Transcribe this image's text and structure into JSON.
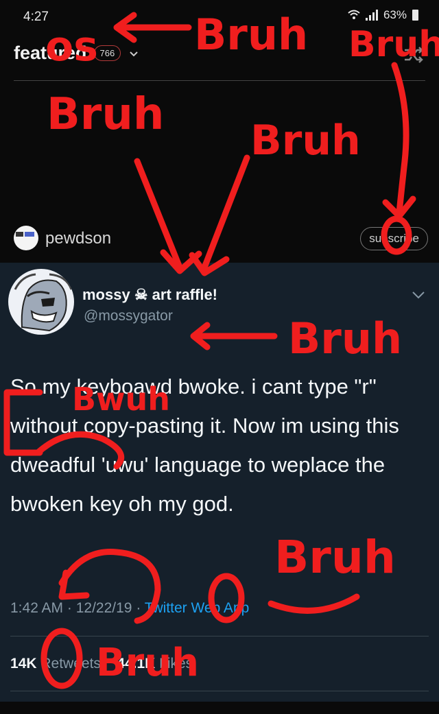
{
  "status_bar": {
    "time": "4:27",
    "battery": "63%"
  },
  "header": {
    "title": "featured",
    "count": "766"
  },
  "post": {
    "author": "pewdson",
    "subscribe_label": "subscribe"
  },
  "tweet": {
    "name": "mossy ☠ art raffle!",
    "handle": "@mossygator",
    "text": "So my keyboawd bwoke. i cant type \"r\" without copy-pasting it. Now im using this dweadful 'uwu' language to weplace the bwoken key oh my god.",
    "time": "1:42 AM",
    "date": "12/22/19",
    "client": "Twitter Web App",
    "retweets": "14K",
    "retweets_label": "Retweets",
    "likes": "44.1K",
    "likes_label": "Likes"
  },
  "annotations": {
    "word": "Bruh",
    "word_alt": "Bwuh",
    "prefix": "os"
  },
  "colors": {
    "scribble": "#f01e1e",
    "tweet_bg": "#15202b",
    "link": "#1da1f2"
  }
}
